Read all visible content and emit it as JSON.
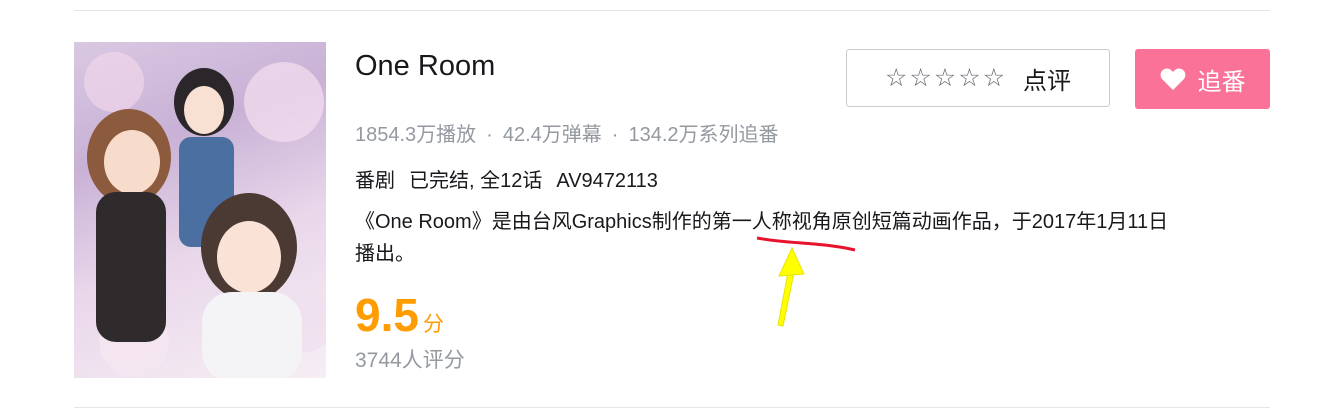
{
  "show": {
    "title": "One Room",
    "stats": {
      "plays": "1854.3万播放",
      "danmaku": "42.4万弹幕",
      "follows": "134.2万系列追番",
      "separator": "·"
    },
    "meta": {
      "type": "番剧",
      "status": "已完结, 全12话",
      "av": "AV9472113"
    },
    "description_line1": "《One Room》是由台风Graphics制作的第一人称视角原创短篇动画作品，于2017年1月11日",
    "description_line2": "播出。",
    "score": "9.5",
    "score_unit": "分",
    "votes": "3744人评分"
  },
  "actions": {
    "rate_stars": "☆☆☆☆☆",
    "rate_label": "点评",
    "follow_label": "追番"
  },
  "colors": {
    "brand_pink": "#fb7299",
    "score_orange": "#ff9c00",
    "annotation_red": "#e8122c",
    "annotation_yellow": "#ffff00"
  },
  "icons": {
    "heart": "heart-icon",
    "star": "star-outline-icon"
  }
}
